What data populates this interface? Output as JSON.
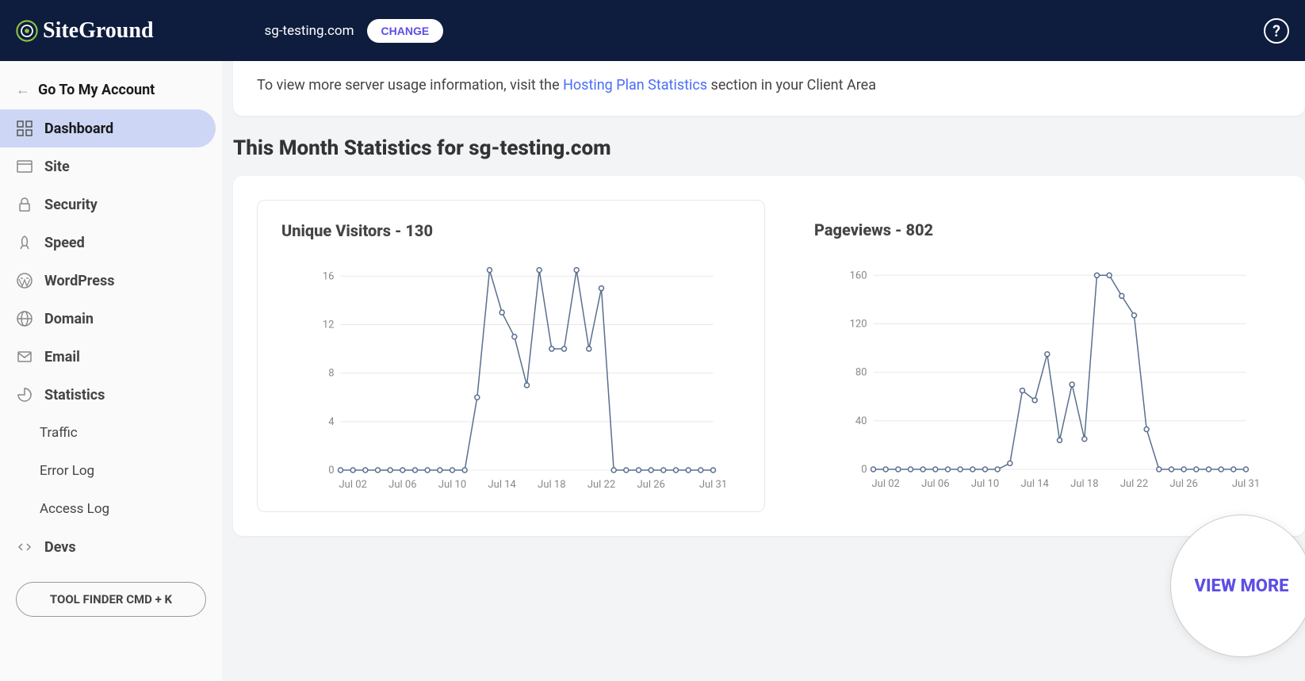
{
  "header": {
    "brand": "SiteGround",
    "domain": "sg-testing.com",
    "change_btn": "CHANGE",
    "help_symbol": "?"
  },
  "sidebar": {
    "back_label": "Go To My Account",
    "items": [
      {
        "label": "Dashboard",
        "icon": "grid"
      },
      {
        "label": "Site",
        "icon": "browser"
      },
      {
        "label": "Security",
        "icon": "lock"
      },
      {
        "label": "Speed",
        "icon": "rocket"
      },
      {
        "label": "WordPress",
        "icon": "wp"
      },
      {
        "label": "Domain",
        "icon": "globe"
      },
      {
        "label": "Email",
        "icon": "mail"
      },
      {
        "label": "Statistics",
        "icon": "chart"
      },
      {
        "label": "Devs",
        "icon": "code"
      }
    ],
    "stats_sub": [
      "Traffic",
      "Error Log",
      "Access Log"
    ],
    "tool_finder": "TOOL FINDER CMD + K"
  },
  "main": {
    "info_prefix": "To view more server usage information, visit the ",
    "info_link": "Hosting Plan Statistics",
    "info_suffix": " section in your Client Area",
    "section_title": "This Month Statistics for sg-testing.com",
    "view_more": "VIEW MORE"
  },
  "chart_data": [
    {
      "type": "line",
      "title": "Unique Visitors - 130",
      "xlabel": "",
      "ylabel": "",
      "ylim": [
        0,
        17
      ],
      "yticks": [
        0,
        4,
        8,
        12,
        16
      ],
      "xticks": [
        "Jul 02",
        "Jul 06",
        "Jul 10",
        "Jul 14",
        "Jul 18",
        "Jul 22",
        "Jul 26",
        "Jul 31"
      ],
      "x": [
        1,
        2,
        3,
        4,
        5,
        6,
        7,
        8,
        9,
        10,
        11,
        12,
        13,
        14,
        15,
        16,
        17,
        18,
        19,
        20,
        21,
        22,
        23,
        24,
        25,
        26,
        27,
        28,
        29,
        30,
        31
      ],
      "values": [
        0,
        0,
        0,
        0,
        0,
        0,
        0,
        0,
        0,
        0,
        0,
        6,
        16.5,
        13,
        11,
        7,
        16.5,
        10,
        10,
        16.5,
        10,
        15,
        0,
        0,
        0,
        0,
        0,
        0,
        0,
        0,
        0
      ]
    },
    {
      "type": "line",
      "title": "Pageviews - 802",
      "xlabel": "",
      "ylabel": "",
      "ylim": [
        0,
        170
      ],
      "yticks": [
        0,
        40,
        80,
        120,
        160
      ],
      "xticks": [
        "Jul 02",
        "Jul 06",
        "Jul 10",
        "Jul 14",
        "Jul 18",
        "Jul 22",
        "Jul 26",
        "Jul 31"
      ],
      "x": [
        1,
        2,
        3,
        4,
        5,
        6,
        7,
        8,
        9,
        10,
        11,
        12,
        13,
        14,
        15,
        16,
        17,
        18,
        19,
        20,
        21,
        22,
        23,
        24,
        25,
        26,
        27,
        28,
        29,
        30,
        31
      ],
      "values": [
        0,
        0,
        0,
        0,
        0,
        0,
        0,
        0,
        0,
        0,
        0,
        5,
        65,
        57,
        95,
        24,
        70,
        25,
        160,
        160,
        143,
        127,
        33,
        0,
        0,
        0,
        0,
        0,
        0,
        0,
        0
      ]
    }
  ]
}
